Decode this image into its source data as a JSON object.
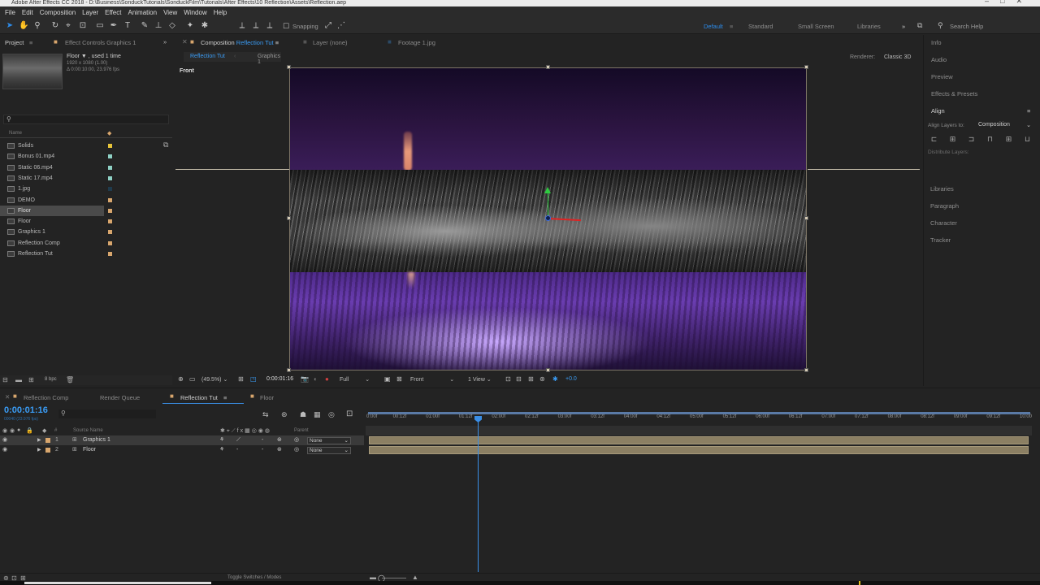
{
  "app": {
    "title": "Adobe After Effects CC 2018 - D:\\Business\\SonduckTutorials\\SonduckFilm\\Tutorials\\After Effects\\10 Reflection\\Assets\\Reflection.aep"
  },
  "menu": [
    "File",
    "Edit",
    "Composition",
    "Layer",
    "Effect",
    "Animation",
    "View",
    "Window",
    "Help"
  ],
  "toolbar": {
    "snapping_label": "Snapping",
    "workspaces": [
      "Default",
      "Standard",
      "Small Screen",
      "Libraries"
    ],
    "active_workspace": "Default",
    "search_help": "Search Help"
  },
  "project_panel": {
    "tab_project": "Project",
    "tab_effects": "Effect Controls Graphics 1",
    "item_name": "Floor ▼ , used 1 time",
    "item_info1": "1920 x 1080 (1.00)",
    "item_info2": "Δ 0:00:10:00, 23.976 fps",
    "col_name": "Name",
    "items": [
      {
        "name": "Solids",
        "color": "#e7c43a"
      },
      {
        "name": "Bonus 01.mp4",
        "color": "#8fd1c5"
      },
      {
        "name": "Static 06.mp4",
        "color": "#8fd1c5"
      },
      {
        "name": "Static 17.mp4",
        "color": "#8fd1c5"
      },
      {
        "name": "1.jpg",
        "color": "#1f3b4d"
      },
      {
        "name": "DEMO",
        "color": "#d8a66d"
      },
      {
        "name": "Floor",
        "color": "#d8a66d"
      },
      {
        "name": "Floor",
        "color": "#d8a66d"
      },
      {
        "name": "Graphics 1",
        "color": "#d8a66d"
      },
      {
        "name": "Reflection Comp",
        "color": "#d8a66d"
      },
      {
        "name": "Reflection Tut",
        "color": "#d8a66d"
      }
    ],
    "footer_bpc": "8 bpc"
  },
  "viewer": {
    "tab_composition_prefix": "Composition",
    "tab_composition_name": "Reflection Tut",
    "tab_layer": "Layer (none)",
    "tab_footage": "Footage 1.jpg",
    "crumbs": [
      "Reflection Tut",
      "Graphics 1"
    ],
    "renderer_label": "Renderer:",
    "renderer_value": "Classic 3D",
    "view_label": "Front",
    "zoom": "(49.5%)",
    "timecode": "0:00:01:16",
    "resolution": "Full",
    "camera": "Front",
    "views": "1 View",
    "exposure": "+0.0"
  },
  "right_panel": {
    "items": [
      "Info",
      "Audio",
      "Preview",
      "Effects & Presets",
      "Align"
    ],
    "align_to_label": "Align Layers to:",
    "align_to_value": "Composition",
    "distribute_label": "Distribute Layers:",
    "sections": [
      "Libraries",
      "Paragraph",
      "Character",
      "Tracker"
    ]
  },
  "timeline": {
    "tabs": [
      "Reflection Comp",
      "Render Queue",
      "Reflection Tut",
      "Floor"
    ],
    "active_tab": "Reflection Tut",
    "timecode": "0:00:01:16",
    "timecode_sub": "00040 (23.976 fps)",
    "col_source": "Source Name",
    "col_parent": "Parent",
    "layers": [
      {
        "num": "1",
        "name": "Graphics 1",
        "parent": "None",
        "color": "#d8a66d"
      },
      {
        "num": "2",
        "name": "Floor",
        "parent": "None",
        "color": "#d8a66d"
      }
    ],
    "ticks": [
      "0:00f",
      "00:12f",
      "01:00f",
      "01:12f",
      "02:00f",
      "02:12f",
      "03:00f",
      "03:12f",
      "04:00f",
      "04:12f",
      "05:00f",
      "05:12f",
      "06:00f",
      "06:12f",
      "07:00f",
      "07:12f",
      "08:00f",
      "08:12f",
      "09:00f",
      "09:12f",
      "10:00"
    ],
    "footer_label": "Toggle Switches / Modes"
  }
}
